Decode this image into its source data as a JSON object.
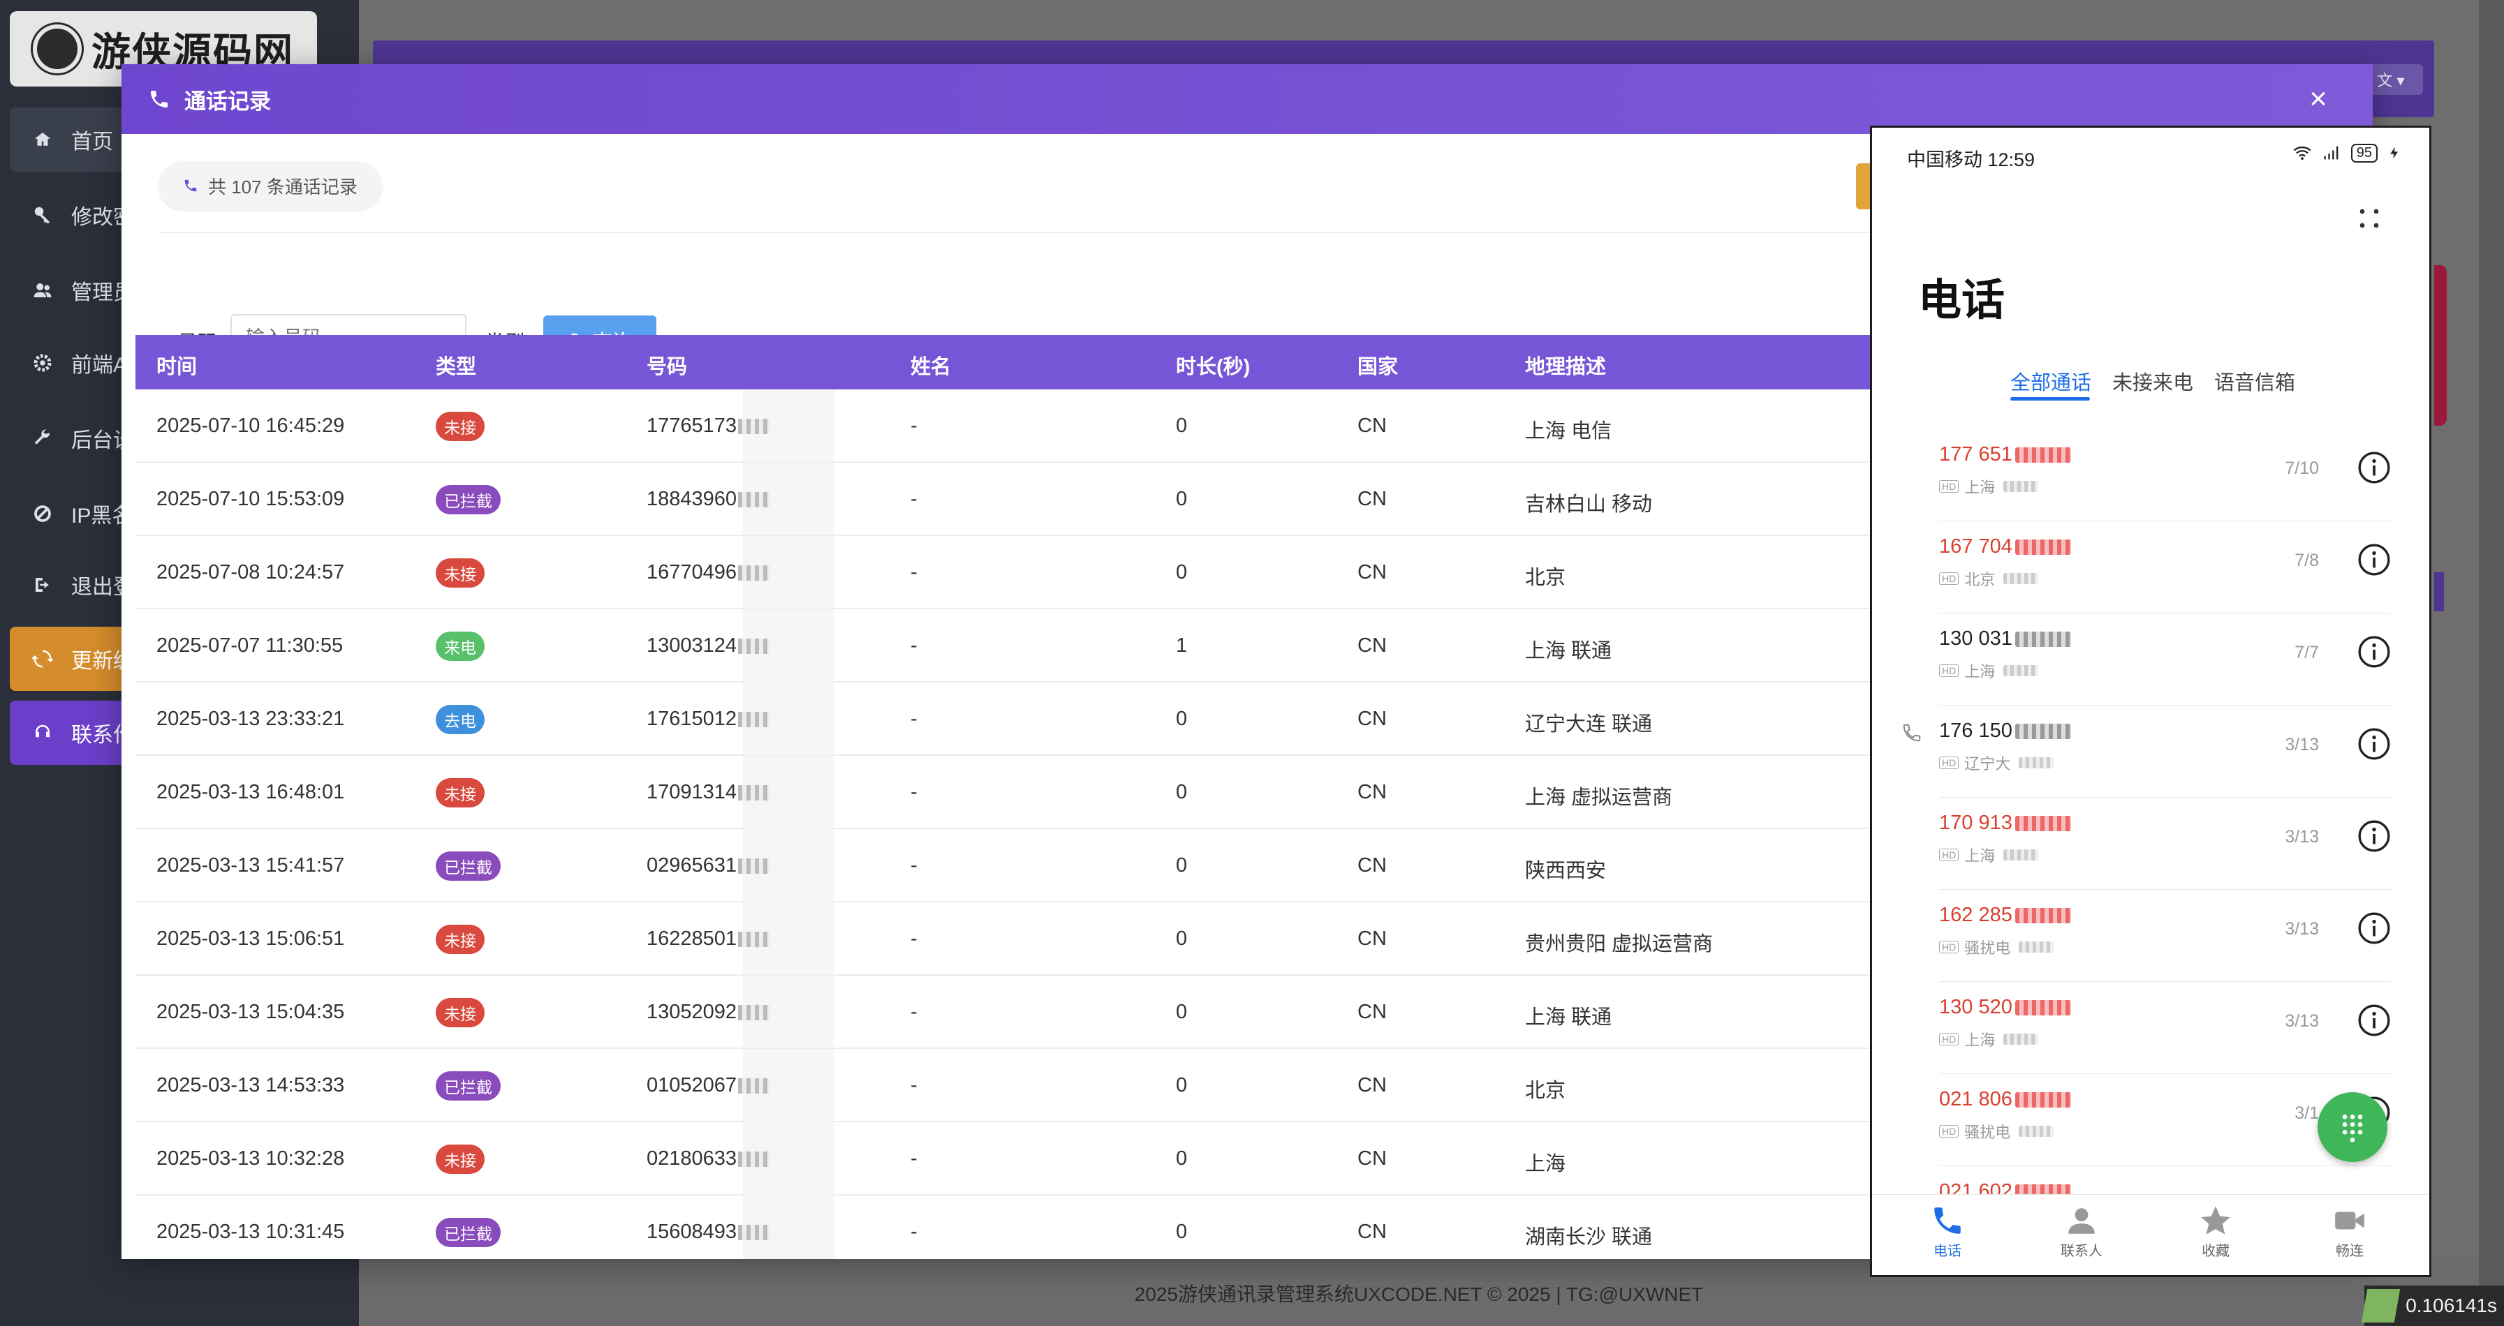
{
  "sidebar": {
    "logo_text": "游侠源码网",
    "items": [
      {
        "label": "首页",
        "icon": "dashboard-icon"
      },
      {
        "label": "修改密",
        "icon": "key-icon"
      },
      {
        "label": "管理员",
        "icon": "users-icon"
      },
      {
        "label": "前端A",
        "icon": "gear-icon"
      },
      {
        "label": "后台设",
        "icon": "wrench-icon"
      },
      {
        "label": "IP黑名",
        "icon": "ban-icon"
      },
      {
        "label": "退出登",
        "icon": "logout-icon"
      },
      {
        "label": "更新缓",
        "icon": "refresh-icon"
      },
      {
        "label": "联系作",
        "icon": "headset-icon"
      }
    ]
  },
  "back_page": {
    "lang_label": "文 ▾",
    "footer": "2025游侠通讯录管理系统UXCODE.NET © 2025 | TG:@UXWNET",
    "timer": "0.106141s"
  },
  "modal": {
    "title": "通话记录",
    "close": "×",
    "count_text": "共 107 条通话记录",
    "filters": {
      "number_label": "号码",
      "number_placeholder": "输入号码",
      "type_label": "类型",
      "query_button": "查询"
    },
    "columns": [
      "时间",
      "类型",
      "号码",
      "姓名",
      "时长(秒)",
      "国家",
      "地理描述"
    ],
    "rows": [
      {
        "time": "2025-07-10 16:45:29",
        "type": "未接",
        "color": "#d9493d",
        "number": "17765173",
        "name": "-",
        "duration": "0",
        "country": "CN",
        "geo": "上海 电信"
      },
      {
        "time": "2025-07-10 15:53:09",
        "type": "已拦截",
        "color": "#8a4bbd",
        "number": "18843960",
        "name": "-",
        "duration": "0",
        "country": "CN",
        "geo": "吉林白山 移动"
      },
      {
        "time": "2025-07-08 10:24:57",
        "type": "未接",
        "color": "#d9493d",
        "number": "16770496",
        "name": "-",
        "duration": "0",
        "country": "CN",
        "geo": "北京"
      },
      {
        "time": "2025-07-07 11:30:55",
        "type": "来电",
        "color": "#58c06a",
        "number": "13003124",
        "name": "-",
        "duration": "1",
        "country": "CN",
        "geo": "上海 联通"
      },
      {
        "time": "2025-03-13 23:33:21",
        "type": "去电",
        "color": "#3e8fdc",
        "number": "17615012",
        "name": "-",
        "duration": "0",
        "country": "CN",
        "geo": "辽宁大连 联通"
      },
      {
        "time": "2025-03-13 16:48:01",
        "type": "未接",
        "color": "#d9493d",
        "number": "17091314",
        "name": "-",
        "duration": "0",
        "country": "CN",
        "geo": "上海 虚拟运营商"
      },
      {
        "time": "2025-03-13 15:41:57",
        "type": "已拦截",
        "color": "#8a4bbd",
        "number": "02965631",
        "name": "-",
        "duration": "0",
        "country": "CN",
        "geo": "陕西西安"
      },
      {
        "time": "2025-03-13 15:06:51",
        "type": "未接",
        "color": "#d9493d",
        "number": "16228501",
        "name": "-",
        "duration": "0",
        "country": "CN",
        "geo": "贵州贵阳 虚拟运营商"
      },
      {
        "time": "2025-03-13 15:04:35",
        "type": "未接",
        "color": "#d9493d",
        "number": "13052092",
        "name": "-",
        "duration": "0",
        "country": "CN",
        "geo": "上海 联通"
      },
      {
        "time": "2025-03-13 14:53:33",
        "type": "已拦截",
        "color": "#8a4bbd",
        "number": "01052067",
        "name": "-",
        "duration": "0",
        "country": "CN",
        "geo": "北京"
      },
      {
        "time": "2025-03-13 10:32:28",
        "type": "未接",
        "color": "#d9493d",
        "number": "02180633",
        "name": "-",
        "duration": "0",
        "country": "CN",
        "geo": "上海"
      },
      {
        "time": "2025-03-13 10:31:45",
        "type": "已拦截",
        "color": "#8a4bbd",
        "number": "15608493",
        "name": "-",
        "duration": "0",
        "country": "CN",
        "geo": "湖南长沙 联通"
      }
    ]
  },
  "phone": {
    "carrier_time": "中国移动 12:59",
    "battery": "95",
    "title": "电话",
    "tabs": [
      "全部通话",
      "未接来电",
      "语音信箱"
    ],
    "calls": [
      {
        "number": "177 651",
        "style": "red",
        "loc": "上海",
        "date": "7/10"
      },
      {
        "number": "167 704",
        "style": "red",
        "loc": "北京",
        "date": "7/8"
      },
      {
        "number": "130 031",
        "style": "black",
        "loc": "上海",
        "date": "7/7"
      },
      {
        "number": "176 150",
        "style": "black",
        "loc": "辽宁大",
        "date": "3/13"
      },
      {
        "number": "170 913",
        "style": "red",
        "loc": "上海",
        "date": "3/13"
      },
      {
        "number": "162 285",
        "style": "red",
        "loc": "骚扰电",
        "date": "3/13"
      },
      {
        "number": "130 520",
        "style": "red",
        "loc": "上海",
        "date": "3/13"
      },
      {
        "number": "021 806",
        "style": "red",
        "loc": "骚扰电",
        "date": "3/1"
      },
      {
        "number": "021 602",
        "style": "red",
        "loc": "",
        "date": ""
      }
    ],
    "nav": [
      "电话",
      "联系人",
      "收藏",
      "畅连"
    ]
  }
}
